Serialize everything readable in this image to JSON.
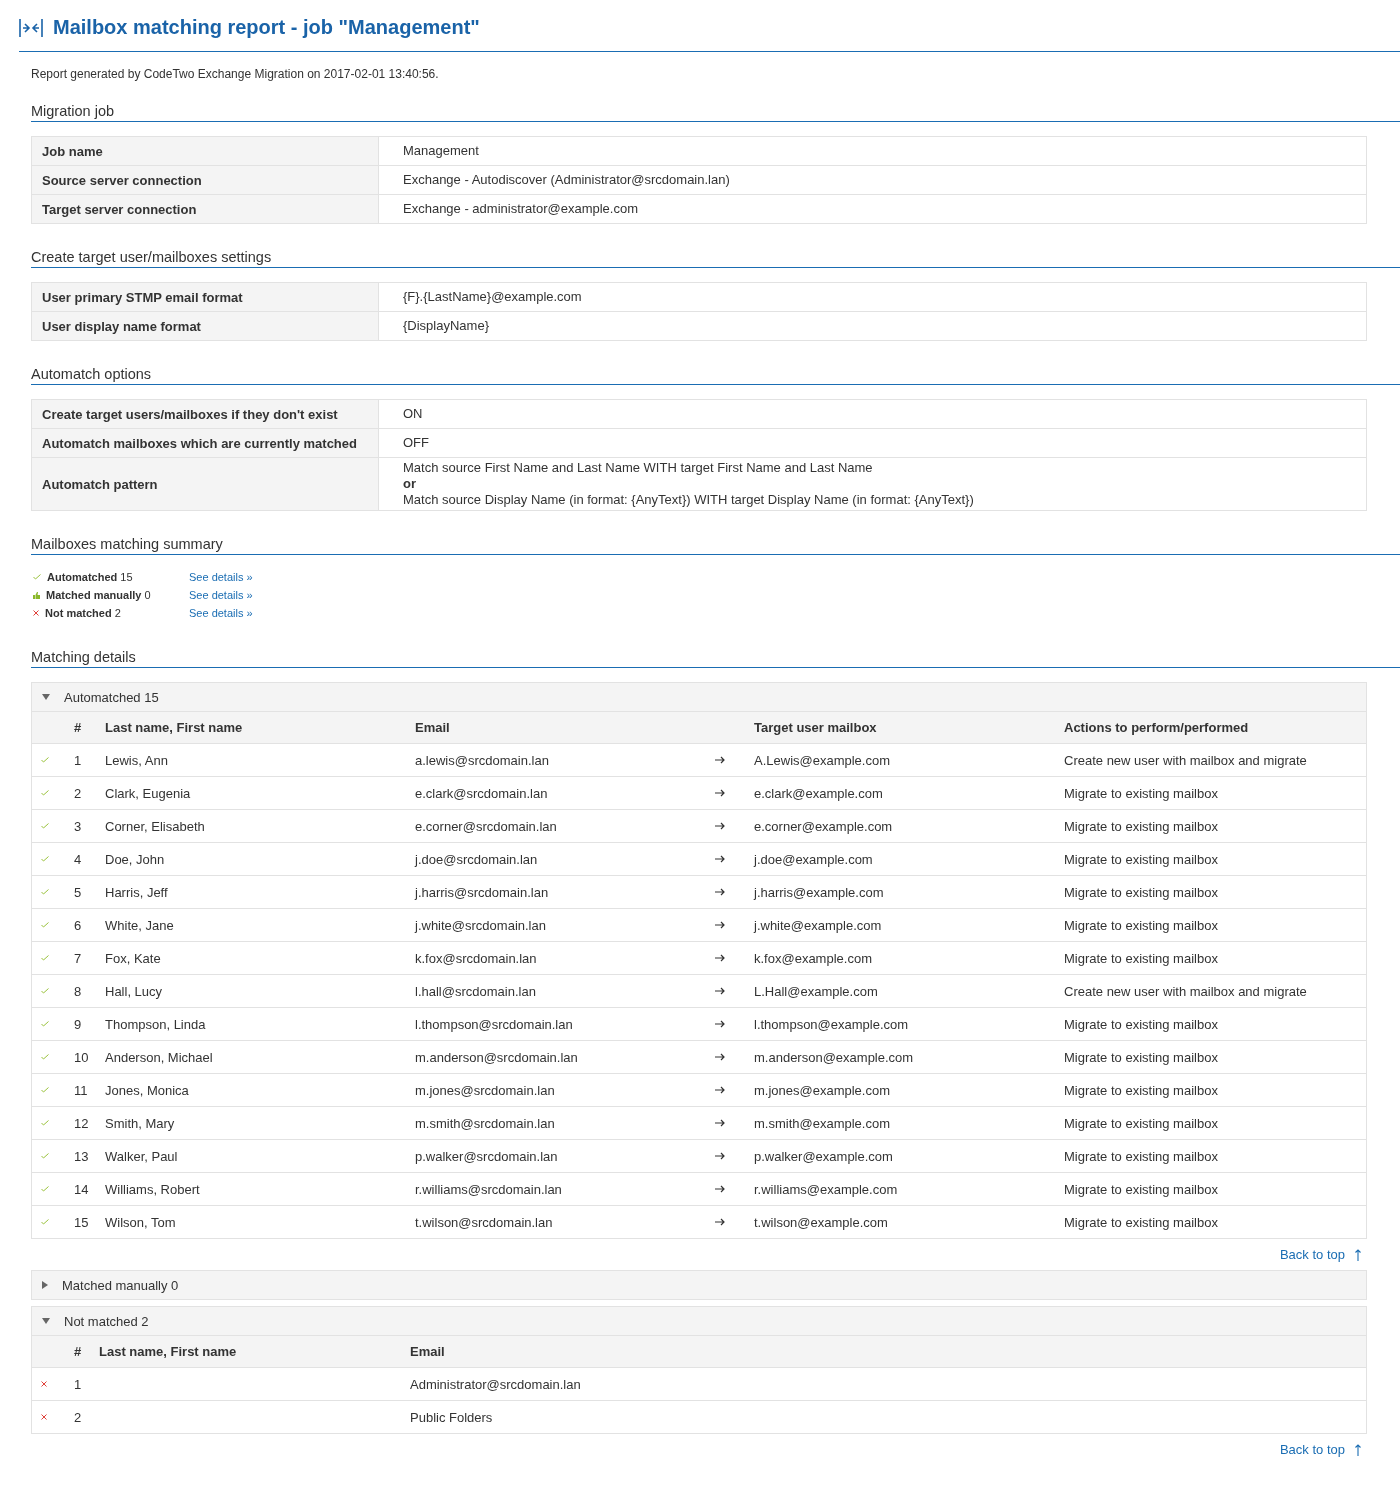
{
  "title": "Mailbox matching report - job \"Management\"",
  "generated": "Report generated by CodeTwo Exchange Migration on 2017-02-01 13:40:56.",
  "sections": [
    {
      "heading": "Migration job",
      "rows": [
        {
          "label": "Job name",
          "value": [
            "Management"
          ]
        },
        {
          "label": "Source server connection",
          "value": [
            "Exchange - Autodiscover (Administrator@srcdomain.lan)"
          ]
        },
        {
          "label": "Target server connection",
          "value": [
            "Exchange - administrator@example.com"
          ]
        }
      ]
    },
    {
      "heading": "Create target user/mailboxes settings",
      "rows": [
        {
          "label": "User primary STMP email format",
          "value": [
            "{F}.{LastName}@example.com"
          ]
        },
        {
          "label": "User display name format",
          "value": [
            "{DisplayName}"
          ]
        }
      ]
    },
    {
      "heading": "Automatch options",
      "rows": [
        {
          "label": "Create target users/mailboxes if they don't exist",
          "value": [
            "ON"
          ]
        },
        {
          "label": "Automatch mailboxes which are currently matched",
          "value": [
            "OFF"
          ]
        },
        {
          "label": "Automatch pattern",
          "value": [
            "Match source First Name and Last Name WITH target First Name and Last Name",
            "**or**",
            "Match source Display Name (in format: {AnyText}) WITH target Display Name (in format: {AnyText})"
          ]
        }
      ]
    }
  ],
  "summary": {
    "heading": "Mailboxes matching summary",
    "items": [
      {
        "kind": "automatched",
        "label": "Automatched",
        "count": "15",
        "link": "See details »"
      },
      {
        "kind": "manual",
        "label": "Matched manually",
        "count": "0",
        "link": "See details »"
      },
      {
        "kind": "not_matched",
        "label": "Not matched",
        "count": "2",
        "link": "See details »"
      }
    ]
  },
  "details": {
    "heading": "Matching details",
    "groups": [
      {
        "title": "Automatched 15",
        "expanded": true,
        "kind": "matched",
        "columns": [
          "#",
          "Last name, First name",
          "Email",
          "Target user mailbox",
          "Actions to perform/performed"
        ],
        "rows": [
          {
            "kind": "automatched",
            "num": "1",
            "name": "Lewis, Ann",
            "email": "a.lewis@srcdomain.lan",
            "target": "A.Lewis@example.com",
            "action": "Create new user with mailbox and migrate"
          },
          {
            "kind": "automatched",
            "num": "2",
            "name": "Clark, Eugenia",
            "email": "e.clark@srcdomain.lan",
            "target": "e.clark@example.com",
            "action": "Migrate to existing mailbox"
          },
          {
            "kind": "automatched",
            "num": "3",
            "name": "Corner, Elisabeth",
            "email": "e.corner@srcdomain.lan",
            "target": "e.corner@example.com",
            "action": "Migrate to existing mailbox"
          },
          {
            "kind": "automatched",
            "num": "4",
            "name": "Doe, John",
            "email": "j.doe@srcdomain.lan",
            "target": "j.doe@example.com",
            "action": "Migrate to existing mailbox"
          },
          {
            "kind": "automatched",
            "num": "5",
            "name": "Harris, Jeff",
            "email": "j.harris@srcdomain.lan",
            "target": "j.harris@example.com",
            "action": "Migrate to existing mailbox"
          },
          {
            "kind": "automatched",
            "num": "6",
            "name": "White, Jane",
            "email": "j.white@srcdomain.lan",
            "target": "j.white@example.com",
            "action": "Migrate to existing mailbox"
          },
          {
            "kind": "automatched",
            "num": "7",
            "name": "Fox, Kate",
            "email": "k.fox@srcdomain.lan",
            "target": "k.fox@example.com",
            "action": "Migrate to existing mailbox"
          },
          {
            "kind": "automatched",
            "num": "8",
            "name": "Hall, Lucy",
            "email": "l.hall@srcdomain.lan",
            "target": "L.Hall@example.com",
            "action": "Create new user with mailbox and migrate"
          },
          {
            "kind": "automatched",
            "num": "9",
            "name": "Thompson, Linda",
            "email": "l.thompson@srcdomain.lan",
            "target": "l.thompson@example.com",
            "action": "Migrate to existing mailbox"
          },
          {
            "kind": "automatched",
            "num": "10",
            "name": "Anderson, Michael",
            "email": "m.anderson@srcdomain.lan",
            "target": "m.anderson@example.com",
            "action": "Migrate to existing mailbox"
          },
          {
            "kind": "automatched",
            "num": "11",
            "name": "Jones, Monica",
            "email": "m.jones@srcdomain.lan",
            "target": "m.jones@example.com",
            "action": "Migrate to existing mailbox"
          },
          {
            "kind": "automatched",
            "num": "12",
            "name": "Smith, Mary",
            "email": "m.smith@srcdomain.lan",
            "target": "m.smith@example.com",
            "action": "Migrate to existing mailbox"
          },
          {
            "kind": "automatched",
            "num": "13",
            "name": "Walker, Paul",
            "email": "p.walker@srcdomain.lan",
            "target": "p.walker@example.com",
            "action": "Migrate to existing mailbox"
          },
          {
            "kind": "automatched",
            "num": "14",
            "name": "Williams, Robert",
            "email": "r.williams@srcdomain.lan",
            "target": "r.williams@example.com",
            "action": "Migrate to existing mailbox"
          },
          {
            "kind": "automatched",
            "num": "15",
            "name": "Wilson, Tom",
            "email": "t.wilson@srcdomain.lan",
            "target": "t.wilson@example.com",
            "action": "Migrate to existing mailbox"
          }
        ],
        "back_to_top": "Back to top"
      },
      {
        "title": "Matched manually 0",
        "expanded": false,
        "kind": "matched"
      },
      {
        "title": "Not matched 2",
        "expanded": true,
        "kind": "unmatched",
        "columns": [
          "#",
          "Last name, First name",
          "Email"
        ],
        "rows": [
          {
            "kind": "not_matched",
            "num": "1",
            "email": "Administrator@srcdomain.lan"
          },
          {
            "kind": "not_matched",
            "num": "2",
            "email": "Public Folders"
          }
        ],
        "back_to_top": "Back to top"
      }
    ]
  }
}
